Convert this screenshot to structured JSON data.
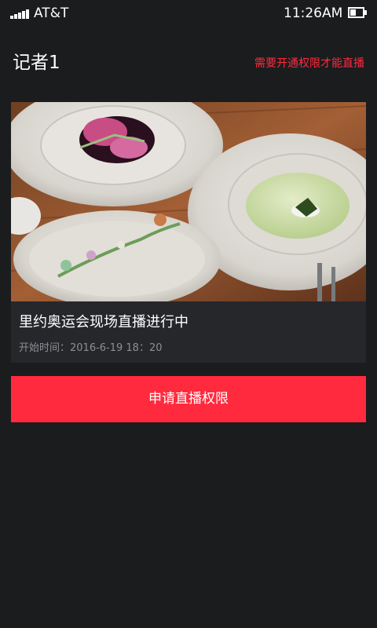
{
  "status_bar": {
    "carrier": "AT&T",
    "time": "11:26AM",
    "icons": [
      "signal-icon",
      "battery-icon"
    ]
  },
  "header": {
    "title": "记者1",
    "permission_note": "需要开通权限才能直播"
  },
  "live_card": {
    "title": "里约奥运会现场直播进行中",
    "start_time": "开始时间：2016-6-19  18：20"
  },
  "apply_button": {
    "label": "申请直播权限"
  },
  "colors": {
    "background": "#1b1c1e",
    "card": "#26272b",
    "accent": "#ff2a3d",
    "muted_text": "#8d8f94"
  }
}
